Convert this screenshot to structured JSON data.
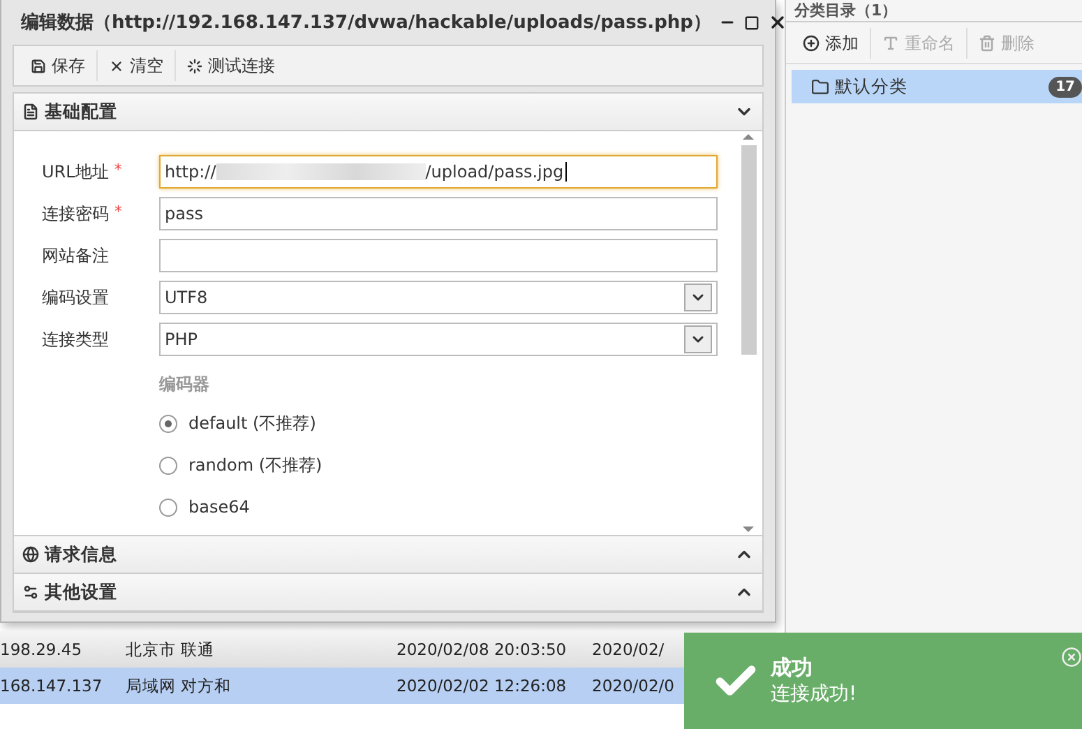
{
  "window": {
    "title": "编辑数据（http://192.168.147.137/dvwa/hackable/uploads/pass.php）"
  },
  "toolbar": [
    {
      "kind": "save",
      "label": "保存"
    },
    {
      "kind": "clear",
      "label": "清空"
    },
    {
      "kind": "test",
      "label": "测试连接"
    }
  ],
  "sections": [
    {
      "kind": "basic",
      "title": "基础配置",
      "expanded": true
    },
    {
      "kind": "request",
      "title": "请求信息",
      "expanded": false
    },
    {
      "kind": "other",
      "title": "其他设置",
      "expanded": false
    }
  ],
  "fields": [
    {
      "kind": "text",
      "label": "URL地址",
      "required_mark": "*",
      "focused": true,
      "value_start": "http://",
      "redacted": true,
      "value_end": "/upload/pass.jpg"
    },
    {
      "kind": "text",
      "label": "连接密码",
      "required_mark": "*",
      "focused": false,
      "value_start": "pass"
    },
    {
      "kind": "text",
      "label": "网站备注",
      "focused": false
    },
    {
      "kind": "select",
      "label": "编码设置",
      "value_start": "UTF8"
    },
    {
      "kind": "select",
      "label": "连接类型",
      "value_start": "PHP"
    }
  ],
  "encoder": {
    "label": "编码器",
    "options": [
      {
        "label": "default (不推荐)",
        "selected": true
      },
      {
        "label": "random (不推荐)",
        "selected": false
      },
      {
        "label": "base64",
        "selected": false
      }
    ]
  },
  "table": {
    "rows": [
      {
        "selected": false,
        "cells": [
          "198.29.45",
          "北京市 联通",
          "2020/02/08 20:03:50",
          "2020/02/"
        ]
      },
      {
        "selected": true,
        "cells": [
          "168.147.137",
          "局域网 对方和",
          "2020/02/02 12:26:08",
          "2020/02/0"
        ]
      }
    ]
  },
  "category_panel": {
    "title": "分类目录（1）",
    "toolbar": [
      {
        "kind": "add",
        "label": "添加",
        "disabled": false
      },
      {
        "kind": "rename",
        "label": "重命名",
        "disabled": true
      },
      {
        "kind": "delete",
        "label": "删除",
        "disabled": true
      }
    ],
    "items": [
      {
        "label": "默认分类",
        "count": "17",
        "selected": true
      }
    ]
  },
  "toast": {
    "title": "成功",
    "message": "连接成功!"
  }
}
